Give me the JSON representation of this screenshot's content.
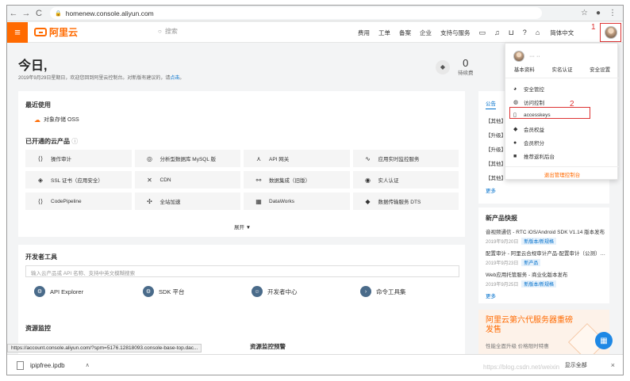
{
  "browser": {
    "url": "homenew.console.aliyun.com"
  },
  "header": {
    "logo_text": "阿里云",
    "search_placeholder": "搜索",
    "nav": [
      "费用",
      "工单",
      "备案",
      "企业",
      "支持与服务"
    ],
    "lang": "简体中文"
  },
  "annotations": {
    "one": "1",
    "two": "2"
  },
  "overview": {
    "title": "今日,",
    "subtitle_prefix": "2019年9月29日星期日，欢迎您回到阿里云控制台。对新版有建议的，请",
    "subtitle_link": "点击",
    "subtitle_suffix": "。",
    "stat_value": "0",
    "stat_label": "待续费"
  },
  "recent": {
    "title": "最近使用",
    "oss": "对象存储 OSS",
    "opened_title": "已开通的云产品",
    "products": [
      "操作审计",
      "分析型数据库 MySQL 版",
      "API 网关",
      "应用实时监控服务",
      "SSL 证书（应用安全）",
      "CDN",
      "数据集成（旧版）",
      "实人认证",
      "CodePipeline",
      "全站加速",
      "DataWorks",
      "数据传输服务 DTS"
    ],
    "expand": "展开 ▼"
  },
  "devtools": {
    "title": "开发者工具",
    "search_placeholder": "输入云产品或 API 名称、支持中英文模糊搜索",
    "items": [
      "API Explorer",
      "SDK 平台",
      "开发者中心",
      "命令工具集"
    ]
  },
  "monitor": {
    "title": "资源监控",
    "alert_title": "资源监控预警"
  },
  "notice": {
    "tab": "公告",
    "rows": [
      "【其他】",
      "【升级】",
      "【升级】",
      "【其他】",
      "【其他】"
    ],
    "more": "更多"
  },
  "news": {
    "title": "新产品快报",
    "items": [
      {
        "title": "音视频通信 - RTC iOS/Android SDK V1.14 版本发布",
        "date": "2019年9月20日",
        "tag": "新版本/新规格"
      },
      {
        "title": "配置审计 - 阿里云合规审计产品-配置审计（公测）发布",
        "date": "2019年9月23日",
        "tag": "新产品"
      },
      {
        "title": "Web应用托管服务 - 商业化版本发布",
        "date": "2019年9月25日",
        "tag": "新版本/新规格"
      }
    ],
    "more": "更多"
  },
  "promo": {
    "title": "阿里云第六代服务器重磅发售",
    "subtitle": "性能全面升级 价格限时特惠"
  },
  "dropdown": {
    "user_name": "··· ··",
    "tabs": [
      "基本资料",
      "实名认证",
      "安全设置"
    ],
    "items": [
      "安全管控",
      "访问控制",
      "accesskeys",
      "会员权益",
      "会员积分",
      "推荐返利后台"
    ],
    "logout": "退出管理控制台"
  },
  "statusbar": {
    "url": "https://account.console.aliyun.com/?spm=5176.12818093.console-base-top.dac..."
  },
  "downloads": {
    "file": "ipipfree.ipdb",
    "show_all": "显示全部",
    "close": "×"
  },
  "watermark": "https://blog.csdn.net/weixin"
}
